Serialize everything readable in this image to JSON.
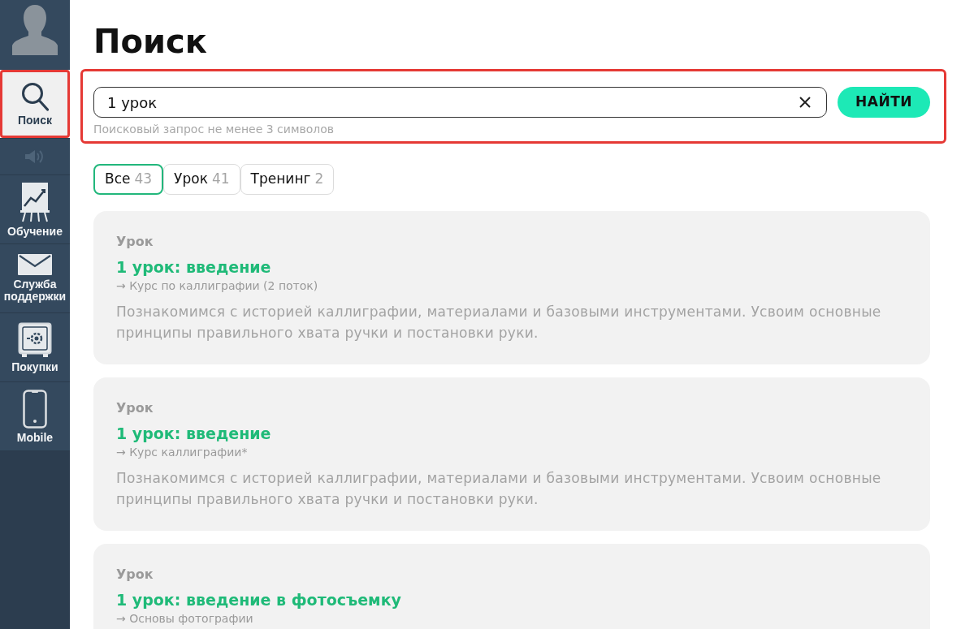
{
  "sidebar": {
    "items": [
      {
        "kind": "link",
        "label": "Поиск",
        "selected": true,
        "highlighted": true
      },
      {
        "kind": "sound",
        "on": false
      },
      {
        "kind": "link",
        "label": "Обучение",
        "selected": false,
        "highlighted": false
      },
      {
        "kind": "link",
        "label": "Служба поддержки",
        "selected": false,
        "highlighted": false
      },
      {
        "kind": "link",
        "label": "Покупки",
        "selected": false,
        "highlighted": false
      },
      {
        "kind": "link",
        "label": "Mobile",
        "selected": false,
        "highlighted": false
      }
    ]
  },
  "page_title": "Поиск",
  "search": {
    "highlighted": true,
    "value": "1 урок",
    "button": "НАЙТИ",
    "hint": "Поисковый запрос не менее 3 символов"
  },
  "tabs": [
    {
      "label": "Все",
      "count": "43",
      "selected": true
    },
    {
      "label": "Урок",
      "count": "41",
      "selected": false
    },
    {
      "label": "Тренинг",
      "count": "2",
      "selected": false
    }
  ],
  "results": [
    {
      "type": "Урок",
      "title": "1 урок: введение",
      "course": "→ Курс по каллиграфии (2 поток)",
      "description": "Познакомимся с историей каллиграфии, материалами и базовыми инструментами. Усвоим основные принципы правильного хвата ручки и постановки руки."
    },
    {
      "type": "Урок",
      "title": "1 урок: введение",
      "course": "→ Курс каллиграфии*",
      "description": "Познакомимся с историей каллиграфии, материалами и базовыми инструментами. Усвоим основные принципы правильного хвата ручки и постановки руки."
    },
    {
      "type": "Урок",
      "title": "1 урок: введение в фотосъемку",
      "course": "→ Основы фотографии"
    }
  ]
}
